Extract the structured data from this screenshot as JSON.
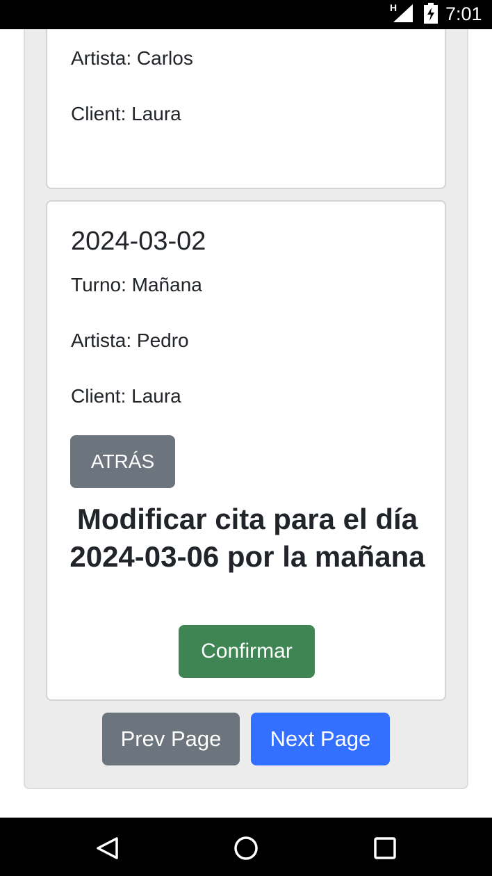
{
  "status_bar": {
    "network": "H",
    "time": "7:01"
  },
  "cards": [
    {
      "artist": "Artista: Carlos",
      "client": "Client: Laura"
    },
    {
      "date": "2024-03-02",
      "shift": "Turno: Mañana",
      "artist": "Artista: Pedro",
      "client": "Client: Laura",
      "back_label": "ATRÁS",
      "modify_heading": "Modificar cita para el día 2024-03-06 por la mañana",
      "confirm_label": "Confirmar"
    }
  ],
  "pagination": {
    "prev_label": "Prev Page",
    "next_label": "Next Page"
  },
  "colors": {
    "secondary": "#6c757d",
    "success": "#3e8553",
    "primary": "#3370ff",
    "panel": "#ececec"
  },
  "icons": [
    "signal-icon",
    "battery-icon",
    "back-nav-icon",
    "home-nav-icon",
    "recents-nav-icon"
  ]
}
